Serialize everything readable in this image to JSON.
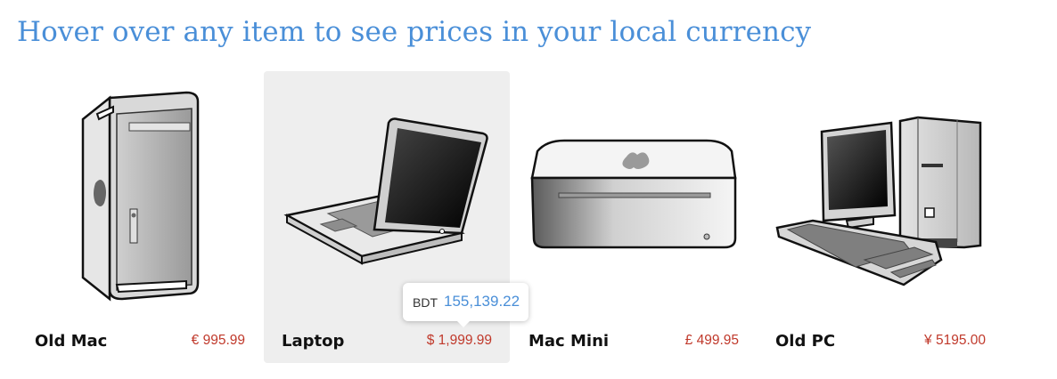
{
  "header": {
    "title": "Hover over any item to see prices in your local currency"
  },
  "products": [
    {
      "name": "Old Mac",
      "price": "€ 995.99",
      "icon": "mac-pro-tower-icon"
    },
    {
      "name": "Laptop",
      "price": "$ 1,999.99",
      "icon": "laptop-icon"
    },
    {
      "name": "Mac Mini",
      "price": "£ 499.95",
      "icon": "mac-mini-icon"
    },
    {
      "name": "Old PC",
      "price": "¥ 5195.00",
      "icon": "desktop-pc-icon"
    }
  ],
  "tooltip": {
    "currency": "BDT",
    "amount": "155,139.22"
  },
  "colors": {
    "title": "#4a8fd8",
    "price": "#c0392b",
    "hover_bg": "#eeeeee"
  }
}
